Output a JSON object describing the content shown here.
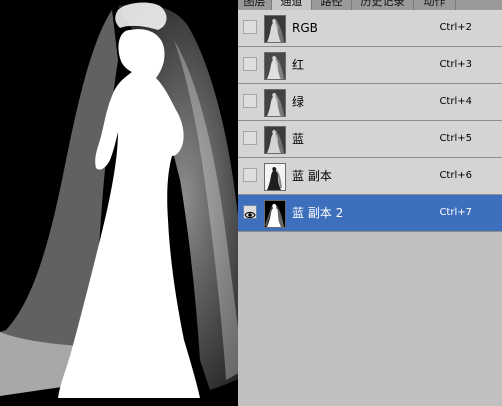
{
  "tabs": [
    "图层",
    "通道",
    "路径",
    "历史记录",
    "动作"
  ],
  "active_tab": 1,
  "channels": [
    {
      "label": "RGB",
      "shortcut": "Ctrl+2",
      "visible": false,
      "selected": false,
      "thumb": "color"
    },
    {
      "label": "红",
      "shortcut": "Ctrl+3",
      "visible": false,
      "selected": false,
      "thumb": "gray"
    },
    {
      "label": "绿",
      "shortcut": "Ctrl+4",
      "visible": false,
      "selected": false,
      "thumb": "gray"
    },
    {
      "label": "蓝",
      "shortcut": "Ctrl+5",
      "visible": false,
      "selected": false,
      "thumb": "gray"
    },
    {
      "label": "蓝 副本",
      "shortcut": "Ctrl+6",
      "visible": false,
      "selected": false,
      "thumb": "gray-light"
    },
    {
      "label": "蓝 副本 2",
      "shortcut": "Ctrl+7",
      "visible": true,
      "selected": true,
      "thumb": "mask"
    }
  ],
  "colors": {
    "selected_row": "#3d6fbd",
    "panel_bg": "#c0c0c0",
    "canvas_bg": "#000000",
    "mask": "#ffffff"
  },
  "icons": {
    "visibility": "eye-icon"
  }
}
